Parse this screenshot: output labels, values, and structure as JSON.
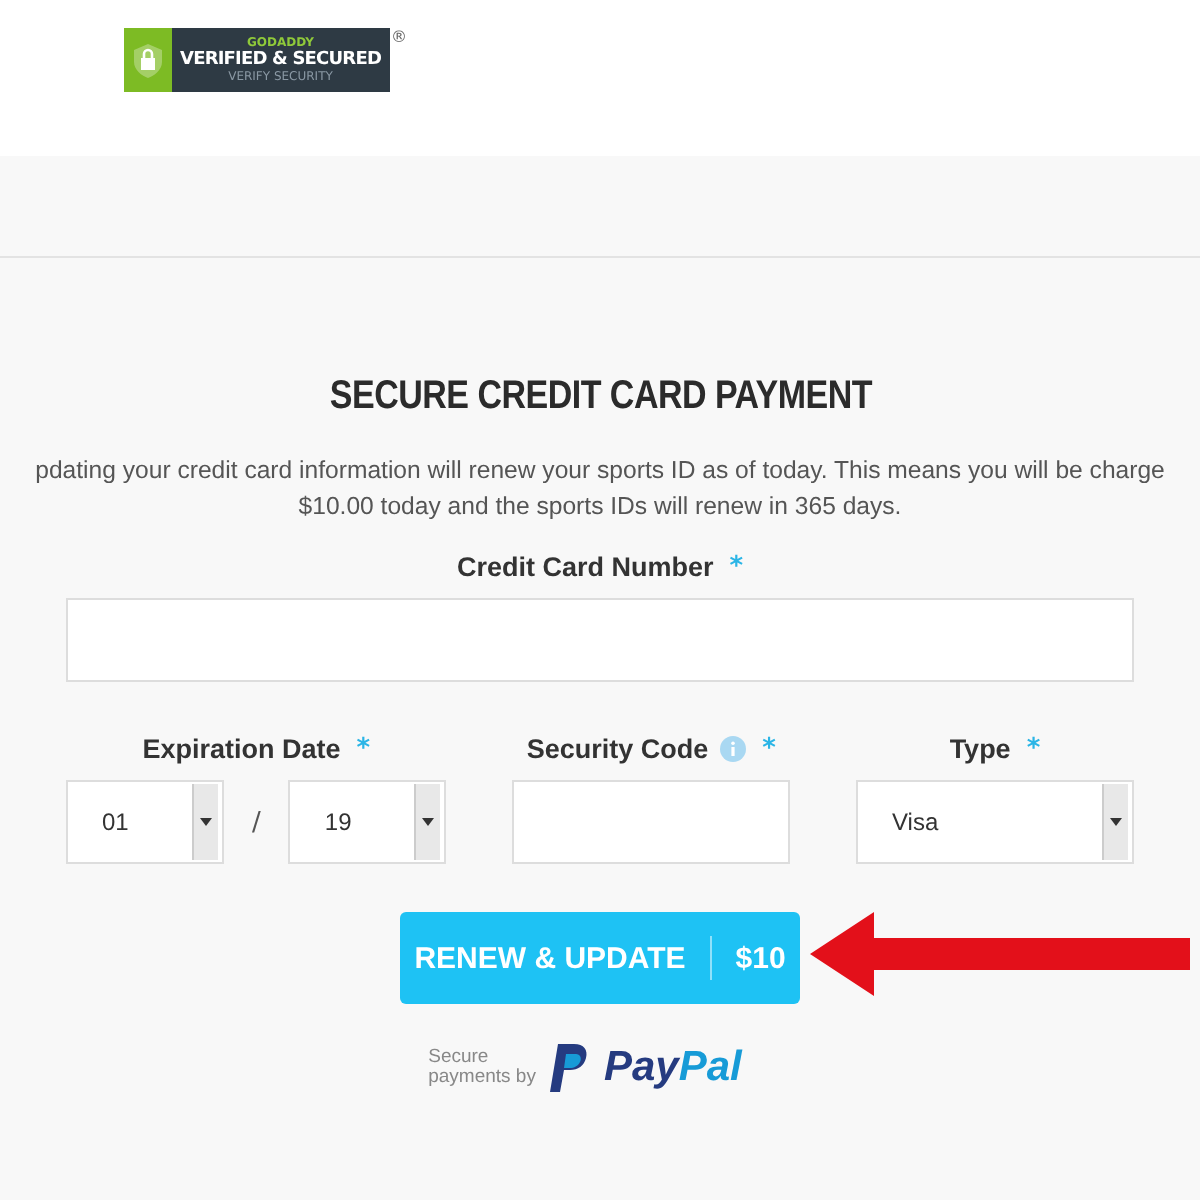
{
  "badge": {
    "brand": "GODADDY",
    "title": "VERIFIED & SECURED",
    "subtitle": "VERIFY SECURITY",
    "mark": "®"
  },
  "heading": "SECURE CREDIT CARD PAYMENT",
  "intro": [
    "pdating your credit card information will renew your sports ID as of today. This means you will be charge",
    "$10.00 today and the sports IDs will renew in 365 days."
  ],
  "card_number": {
    "label": "Credit Card Number",
    "required": "*"
  },
  "expiration": {
    "label": "Expiration Date",
    "required": "*",
    "month": "01",
    "separator": "/",
    "year": "19"
  },
  "security_code": {
    "label": "Security Code",
    "required": "*"
  },
  "type": {
    "label": "Type",
    "required": "*",
    "value": "Visa"
  },
  "button": {
    "label": "RENEW & UPDATE",
    "price": "$10"
  },
  "paypal": {
    "caption": [
      "Secure",
      "payments by"
    ],
    "logo": [
      "Pay",
      "Pal"
    ]
  }
}
